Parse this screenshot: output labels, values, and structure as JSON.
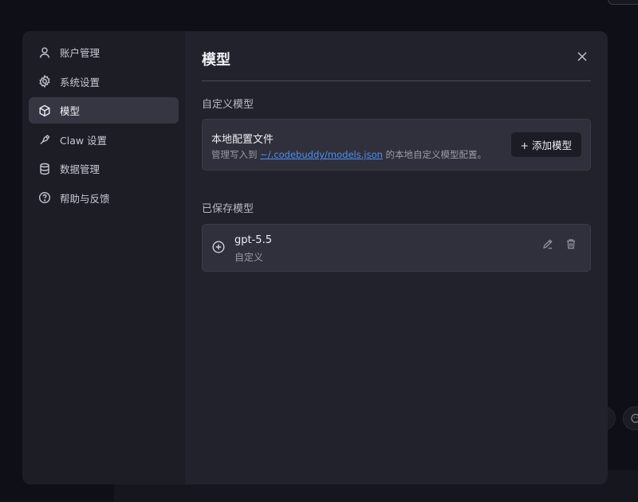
{
  "sidebar": {
    "items": [
      {
        "label": "账户管理",
        "icon": "user-icon",
        "active": false
      },
      {
        "label": "系统设置",
        "icon": "gear-icon",
        "active": false
      },
      {
        "label": "模型",
        "icon": "cube-icon",
        "active": true
      },
      {
        "label": "Claw 设置",
        "icon": "claw-icon",
        "active": false
      },
      {
        "label": "数据管理",
        "icon": "database-icon",
        "active": false
      },
      {
        "label": "帮助与反馈",
        "icon": "help-circle-icon",
        "active": false
      }
    ]
  },
  "main": {
    "title": "模型",
    "custom_section_title": "自定义模型",
    "local_config": {
      "title": "本地配置文件",
      "desc_prefix": "管理写入到 ",
      "desc_link": "~/.codebuddy/models.json",
      "desc_suffix": " 的本地自定义模型配置。",
      "add_button": "+ 添加模型"
    },
    "saved_section_title": "已保存模型",
    "saved_models": [
      {
        "name": "gpt-5.5",
        "type": "自定义"
      }
    ]
  },
  "colors": {
    "accent_link": "#4f8ff0",
    "active_nav_bg": "#363642",
    "modal_bg": "#22222c",
    "sidebar_bg": "#1d1d26"
  }
}
